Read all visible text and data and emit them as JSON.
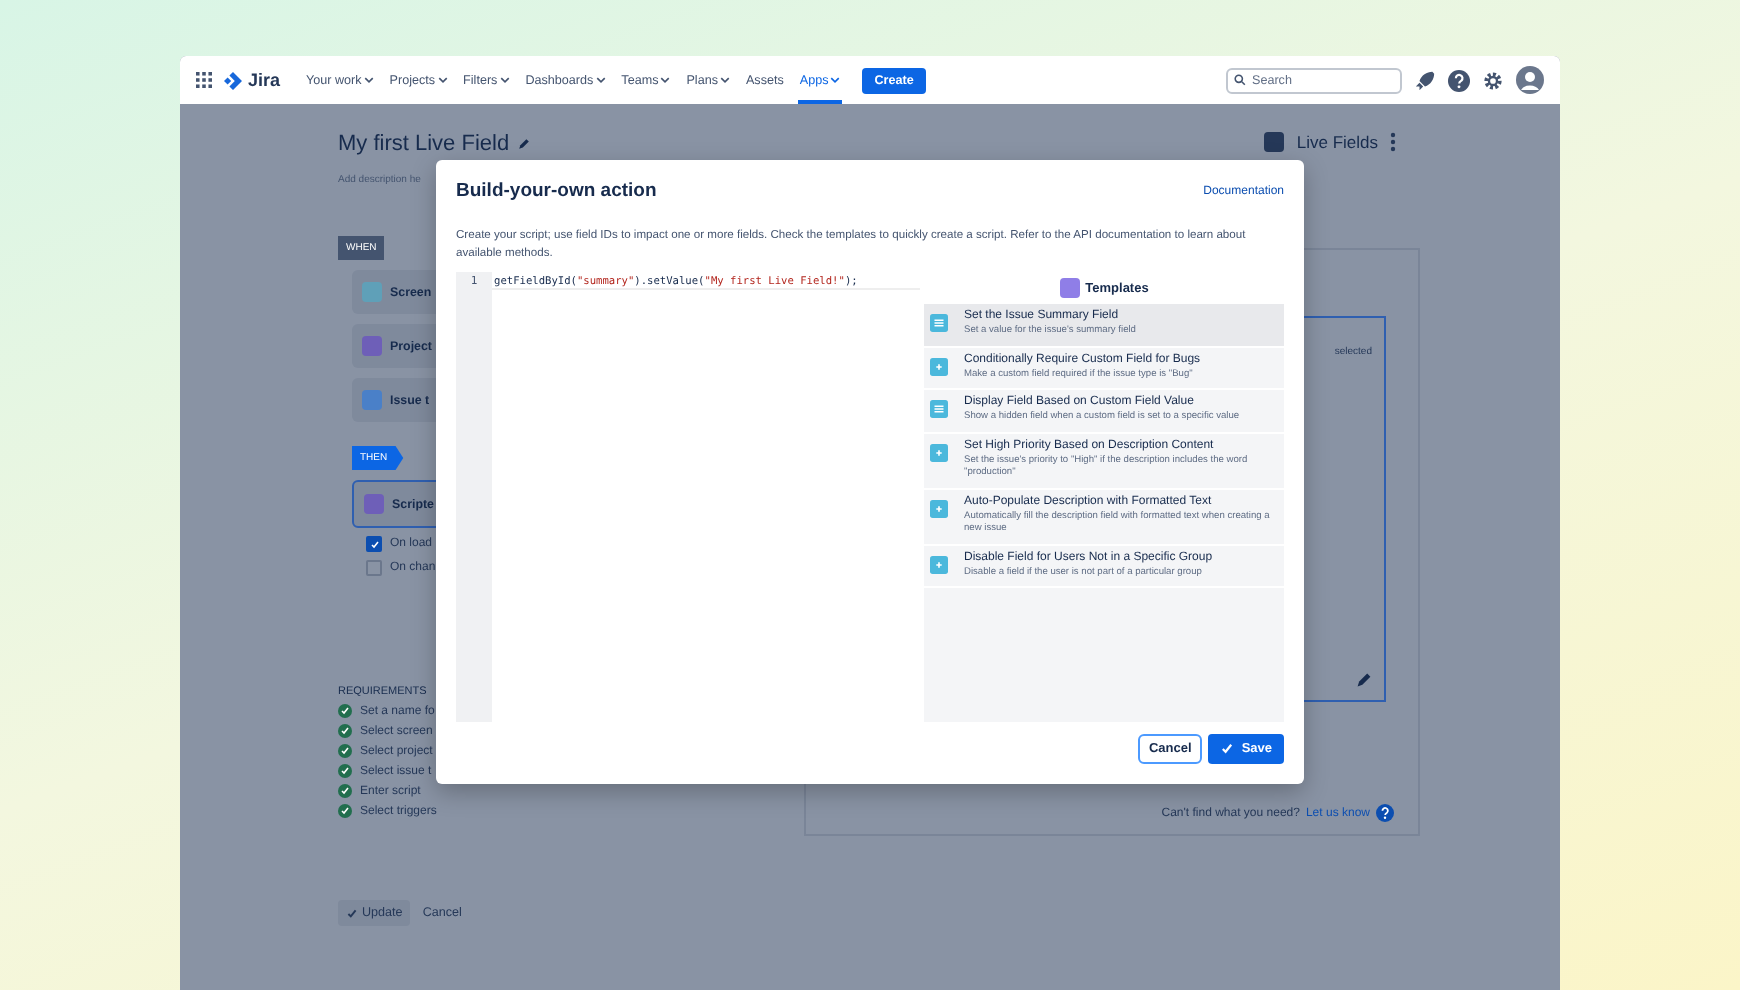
{
  "nav": {
    "logo": "Jira",
    "items": [
      {
        "label": "Your work",
        "dropdown": true,
        "selected": false
      },
      {
        "label": "Projects",
        "dropdown": true,
        "selected": false
      },
      {
        "label": "Filters",
        "dropdown": true,
        "selected": false
      },
      {
        "label": "Dashboards",
        "dropdown": true,
        "selected": false
      },
      {
        "label": "Teams",
        "dropdown": true,
        "selected": false
      },
      {
        "label": "Plans",
        "dropdown": true,
        "selected": false
      },
      {
        "label": "Assets",
        "dropdown": false,
        "selected": false
      },
      {
        "label": "Apps",
        "dropdown": true,
        "selected": true
      }
    ],
    "create": "Create",
    "search": {
      "placeholder": "Search"
    }
  },
  "page": {
    "title": "My first Live Field",
    "description": "Add description he",
    "app_name": "Live Fields",
    "when_badge": "WHEN",
    "when_cards": [
      {
        "label": "Screen",
        "kind": "screen"
      },
      {
        "label": "Project",
        "kind": "project"
      },
      {
        "label": "Issue t",
        "kind": "issue"
      }
    ],
    "then_badge": "THEN",
    "then_card": "Scripte",
    "triggers": [
      {
        "label": "On load",
        "checked": true
      },
      {
        "label": "On chan",
        "checked": false
      }
    ],
    "requirements_title": "REQUIREMENTS",
    "requirements": [
      {
        "label": "Set a name fo",
        "done": true
      },
      {
        "label": "Select screen",
        "done": true
      },
      {
        "label": "Select project",
        "done": true
      },
      {
        "label": "Select issue t",
        "done": true
      },
      {
        "label": "Enter script",
        "done": true
      },
      {
        "label": "Select triggers",
        "done": true
      }
    ],
    "panel_text": "selected",
    "help_text": "Can't find what you need?",
    "help_link": "Let us know",
    "update": "Update",
    "cancel": "Cancel"
  },
  "modal": {
    "title": "Build-your-own action",
    "doc_link": "Documentation",
    "description": "Create your script; use field IDs to impact one or more fields. Check the templates to quickly create a script. Refer to the API documentation to learn about available methods.",
    "code_lines": [
      {
        "number": "1",
        "tokens": [
          {
            "text": "getFieldById(",
            "kind": "plain"
          },
          {
            "text": "\"summary\"",
            "kind": "string"
          },
          {
            "text": ").setValue(",
            "kind": "plain"
          },
          {
            "text": "\"My first Live Field!\"",
            "kind": "string"
          },
          {
            "text": ");",
            "kind": "plain"
          }
        ]
      }
    ],
    "templates_title": "Templates",
    "templates": [
      {
        "title": "Set the Issue Summary Field",
        "description": "Set a value for the issue's summary field",
        "kind": "lines",
        "selected": true
      },
      {
        "title": "Conditionally Require Custom Field for Bugs",
        "description": "Make a custom field required if the issue type is \"Bug\"",
        "kind": "plus",
        "selected": false
      },
      {
        "title": "Display Field Based on Custom Field Value",
        "description": "Show a hidden field when a custom field is set to a specific value",
        "kind": "lines",
        "selected": false
      },
      {
        "title": "Set High Priority Based on Description Content",
        "description": "Set the issue's priority to \"High\" if the description includes the word \"production\"",
        "kind": "plus",
        "selected": false
      },
      {
        "title": "Auto-Populate Description with Formatted Text",
        "description": "Automatically fill the description field with formatted text when creating a new issue",
        "kind": "plus",
        "selected": false
      },
      {
        "title": "Disable Field for Users Not in a Specific Group",
        "description": "Disable a field if the user is not part of a particular group",
        "kind": "plus",
        "selected": false
      }
    ],
    "cancel": "Cancel",
    "save": "Save"
  }
}
